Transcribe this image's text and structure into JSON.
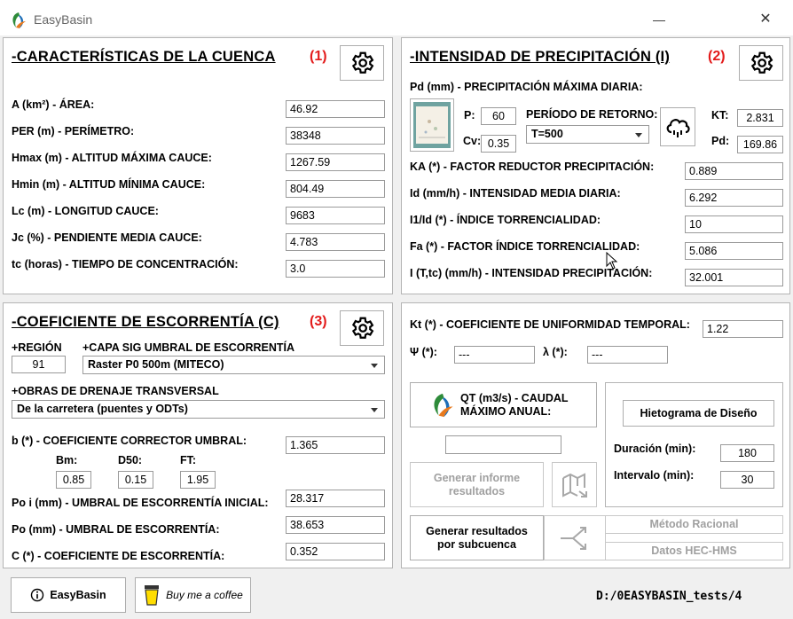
{
  "app": {
    "title": "EasyBasin",
    "minimize": "—",
    "close": "✕"
  },
  "p1": {
    "title": "-CARACTERÍSTICAS DE LA CUENCA",
    "num": "(1)",
    "rows": [
      {
        "label": "A (km²) - ÁREA:",
        "value": "46.92"
      },
      {
        "label": "PER (m) - PERÍMETRO:",
        "value": "38348"
      },
      {
        "label": "Hmax (m) - ALTITUD MÁXIMA CAUCE:",
        "value": "1267.59"
      },
      {
        "label": "Hmin (m) - ALTITUD MÍNIMA CAUCE:",
        "value": "804.49"
      },
      {
        "label": "Lc (m) - LONGITUD CAUCE:",
        "value": "9683"
      },
      {
        "label": "Jc (%) - PENDIENTE MEDIA CAUCE:",
        "value": "4.783"
      },
      {
        "label": "tc (horas) - TIEMPO DE CONCENTRACIÓN:",
        "value": "3.0"
      }
    ]
  },
  "p2": {
    "title": "-INTENSIDAD DE PRECIPITACIÓN (I)",
    "num": "(2)",
    "pd_label": "Pd (mm) - PRECIPITACIÓN MÁXIMA DIARIA:",
    "p_label": "P:",
    "p_value": "60",
    "cv_label": "Cv:",
    "cv_value": "0.35",
    "periodo_label": "PERÍODO DE RETORNO:",
    "periodo_value": "T=500",
    "kt_label": "KT:",
    "kt_value": "2.831",
    "pd_short": "Pd:",
    "pd_value": "169.86",
    "rows": [
      {
        "label": "KA (*) - FACTOR REDUCTOR PRECIPITACIÓN:",
        "value": "0.889"
      },
      {
        "label": "Id (mm/h) - INTENSIDAD MEDIA DIARIA:",
        "value": "6.292"
      },
      {
        "label": "I1/Id (*) - ÍNDICE TORRENCIALIDAD:",
        "value": "10"
      },
      {
        "label": "Fa (*) - FACTOR ÍNDICE TORRENCIALIDAD:",
        "value": "5.086"
      },
      {
        "label": "I (T,tc) (mm/h) - INTENSIDAD PRECIPITACIÓN:",
        "value": "32.001"
      }
    ]
  },
  "p3": {
    "title": "-COEFICIENTE DE ESCORRENTÍA (C)",
    "num": "(3)",
    "region_label": "+REGIÓN",
    "region_value": "91",
    "capa_label": "+CAPA SIG UMBRAL DE ESCORRENTÍA",
    "capa_value": "Raster P0 500m (MITECO)",
    "obras_label": "+OBRAS DE DRENAJE TRANSVERSAL",
    "obras_value": "De la carretera (puentes y ODTs)",
    "b_label": "b (*) - COEFICIENTE CORRECTOR UMBRAL:",
    "b_value": "1.365",
    "bm_label": "Bm:",
    "bm_value": "0.85",
    "d50_label": "D50:",
    "d50_value": "0.15",
    "ft_label": "FT:",
    "ft_value": "1.95",
    "poi_label": "Po i (mm) - UMBRAL DE ESCORRENTÍA INICIAL:",
    "poi_value": "28.317",
    "po_label": "Po (mm) - UMBRAL DE ESCORRENTÍA:",
    "po_value": "38.653",
    "c_label": "C (*) - COEFICIENTE DE ESCORRENTÍA:",
    "c_value": "0.352"
  },
  "p4": {
    "kt_label": "Kt (*) - COEFICIENTE DE UNIFORMIDAD TEMPORAL:",
    "kt_value": "1.22",
    "psi_label": "Ψ (*):",
    "psi_value": "---",
    "lambda_label": "λ (*):",
    "lambda_value": "---",
    "qt_label": "QT (m3/s) - CAUDAL MÁXIMO ANUAL:",
    "qt_value": "",
    "informe_label": "Generar informe resultados",
    "hieto_label": "Hietograma de Diseño",
    "duracion_label": "Duración (min):",
    "duracion_value": "180",
    "intervalo_label": "Intervalo (min):",
    "intervalo_value": "30",
    "subcuenca_label": "Generar resultados por subcuenca",
    "racional_label": "Método Racional",
    "hechms_label": "Datos HEC-HMS"
  },
  "bottom": {
    "easybasin_label": "EasyBasin",
    "coffee_label": "Buy me a coffee",
    "path": "D:/0EASYBASIN_tests/4"
  }
}
